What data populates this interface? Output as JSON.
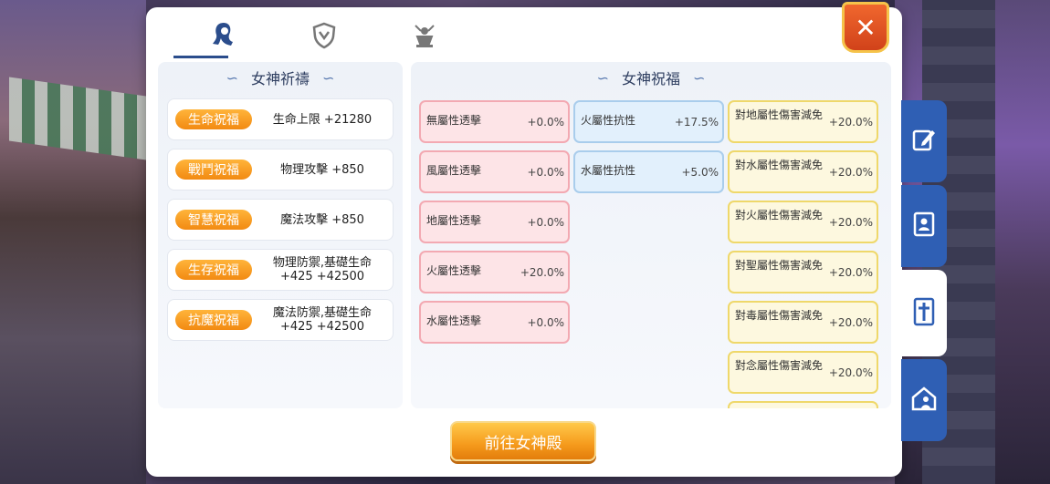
{
  "tabs": [
    {
      "icon": "goddess-icon",
      "active": true
    },
    {
      "icon": "shield-icon",
      "active": false
    },
    {
      "icon": "statue-icon",
      "active": false
    }
  ],
  "close_label": "✕",
  "left_section": {
    "title": "女神祈禱",
    "items": [
      {
        "label": "生命祝福",
        "value": "生命上限 +21280"
      },
      {
        "label": "戰鬥祝福",
        "value": "物理攻擊 +850"
      },
      {
        "label": "智慧祝福",
        "value": "魔法攻擊 +850"
      },
      {
        "label": "生存祝福",
        "value": "物理防禦,基礎生命 +425 +42500"
      },
      {
        "label": "抗魔祝福",
        "value": "魔法防禦,基礎生命 +425 +42500"
      }
    ]
  },
  "right_section": {
    "title": "女神祝福",
    "col1": [
      {
        "name": "無屬性透擊",
        "value": "+0.0%"
      },
      {
        "name": "風屬性透擊",
        "value": "+0.0%"
      },
      {
        "name": "地屬性透擊",
        "value": "+0.0%"
      },
      {
        "name": "火屬性透擊",
        "value": "+20.0%"
      },
      {
        "name": "水屬性透擊",
        "value": "+0.0%"
      }
    ],
    "col2": [
      {
        "name": "火屬性抗性",
        "value": "+17.5%"
      },
      {
        "name": "水屬性抗性",
        "value": "+5.0%"
      }
    ],
    "col3": [
      {
        "name": "對地屬性傷害減免",
        "value": "+20.0%"
      },
      {
        "name": "對水屬性傷害減免",
        "value": "+20.0%"
      },
      {
        "name": "對火屬性傷害減免",
        "value": "+20.0%"
      },
      {
        "name": "對聖屬性傷害減免",
        "value": "+20.0%"
      },
      {
        "name": "對毒屬性傷害減免",
        "value": "+20.0%"
      },
      {
        "name": "對念屬性傷害減免",
        "value": "+20.0%"
      }
    ]
  },
  "go_button": "前往女神殿",
  "side_tabs": [
    {
      "icon": "edit-icon",
      "active": false
    },
    {
      "icon": "contacts-book-icon",
      "active": false
    },
    {
      "icon": "cross-icon",
      "active": true
    },
    {
      "icon": "home-person-icon",
      "active": false
    }
  ],
  "colors": {
    "accent_orange": "#f28a12",
    "side_tab_blue": "#2f5fb4",
    "cell_red_border": "#f3a9b2",
    "cell_blue_border": "#a9cdec",
    "cell_yellow_border": "#efd86a"
  }
}
